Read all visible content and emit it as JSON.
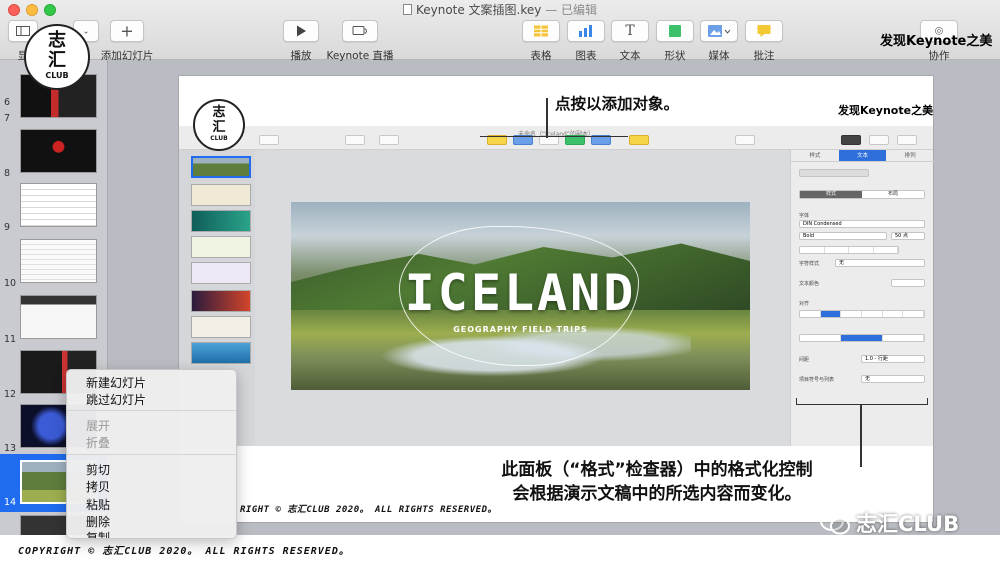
{
  "window": {
    "title": "Keynote 文案插图.key",
    "edited": "— 已编辑"
  },
  "toolbar": {
    "view_label": "显",
    "zoom_label": "%",
    "add_slide": "添加幻灯片",
    "play": "播放",
    "keynote_live": "Keynote 直播",
    "table": "表格",
    "chart": "图表",
    "text": "文本",
    "shape": "形状",
    "media": "媒体",
    "comment": "批注",
    "collaborate": "协作"
  },
  "watermark_top": "发现Keynote之美",
  "badge": {
    "top": "志",
    "mid": "汇",
    "bottom": "CLUB"
  },
  "navigator": {
    "slides": [
      {
        "num": "6"
      },
      {
        "num": "7"
      },
      {
        "num": "8"
      },
      {
        "num": "9"
      },
      {
        "num": "10"
      },
      {
        "num": "11"
      },
      {
        "num": "12"
      },
      {
        "num": "13"
      },
      {
        "num": "14",
        "selected": true
      }
    ]
  },
  "context_menu": {
    "items": [
      {
        "label": "新建幻灯片",
        "enabled": true
      },
      {
        "label": "跳过幻灯片",
        "enabled": true
      },
      {
        "label": "展开",
        "enabled": false
      },
      {
        "label": "折叠",
        "enabled": false
      },
      {
        "label": "剪切",
        "enabled": true
      },
      {
        "label": "拷贝",
        "enabled": true
      },
      {
        "label": "粘贴",
        "enabled": true
      },
      {
        "label": "删除",
        "enabled": true
      },
      {
        "label": "复制",
        "enabled": true
      }
    ]
  },
  "inner": {
    "callout_top": "点按以添加对象。",
    "watermark": "发现Keynote之美",
    "window_title": "未命名（“Iceland”的副本）",
    "inspector_tabs": [
      "样式",
      "文本",
      "排列"
    ],
    "inspector": {
      "style_tab": "样式",
      "layout_tab": "布局",
      "font_label": "字体",
      "font_name": "DIN Condensed",
      "font_weight": "Bold",
      "font_size": "50 点",
      "char_style_label": "字符样式",
      "char_style_value": "无",
      "text_color_label": "文本颜色",
      "align_label": "对齐",
      "spacing_label": "间距",
      "spacing_value": "1.0 - 行距",
      "bullets_label": "项目符号与列表",
      "bullets_value": "无"
    },
    "slide": {
      "title": "ICELAND",
      "subtitle": "GEOGRAPHY FIELD TRIPS"
    },
    "callout_bottom_line1": "此面板（“格式”检查器）中的格式化控制",
    "callout_bottom_line2": "会根据演示文稿中的所选内容而变化。",
    "copyright": "RIGHT © 志汇CLUB 2020。 ALL RIGHTS RESERVED。"
  },
  "copyright": "COPYRIGHT © 志汇CLUB 2020。 ALL RIGHTS RESERVED。",
  "wechat_label": "志汇CLUB",
  "colors": {
    "accent": "#1f6cf0",
    "table": "#f4c43a",
    "chart": "#3a86e8",
    "shape": "#3cc06a",
    "comment": "#f2c833"
  }
}
